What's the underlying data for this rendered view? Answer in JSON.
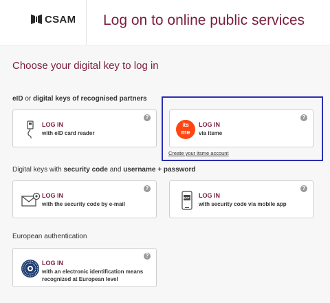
{
  "header": {
    "logo_text": "CSAM",
    "title": "Log on to online public services"
  },
  "main": {
    "heading": "Choose your digital key to log in",
    "group1": {
      "label_a": "eID",
      "label_b": " or ",
      "label_c": "digital keys of recognised partners"
    },
    "group2": {
      "label_a": "Digital keys with ",
      "label_b": "security code",
      "label_c": " and ",
      "label_d": "username + password"
    },
    "group3": {
      "label": "European authentication"
    },
    "cards": {
      "eid": {
        "title": "LOG IN",
        "subtitle": "with eID card reader"
      },
      "itsme": {
        "title": "LOG IN",
        "subtitle": "via itsme",
        "logo_top": "its",
        "logo_bottom": "me"
      },
      "email": {
        "title": "LOG IN",
        "subtitle": "with the security code by e-mail"
      },
      "mobile": {
        "title": "LOG IN",
        "subtitle": "with security code via mobile app",
        "app_badge": "APP"
      },
      "european": {
        "title": "LOG IN",
        "subtitle_1": "with an electronic identification means",
        "subtitle_2": "recognized at European level"
      }
    },
    "help_glyph": "?",
    "create_itsme_link": "Create your itsme account"
  },
  "colors": {
    "brand": "#7a1e3d",
    "highlight": "#2a2fb0",
    "itsme": "#ff4612",
    "background": "#f7f7f7"
  }
}
